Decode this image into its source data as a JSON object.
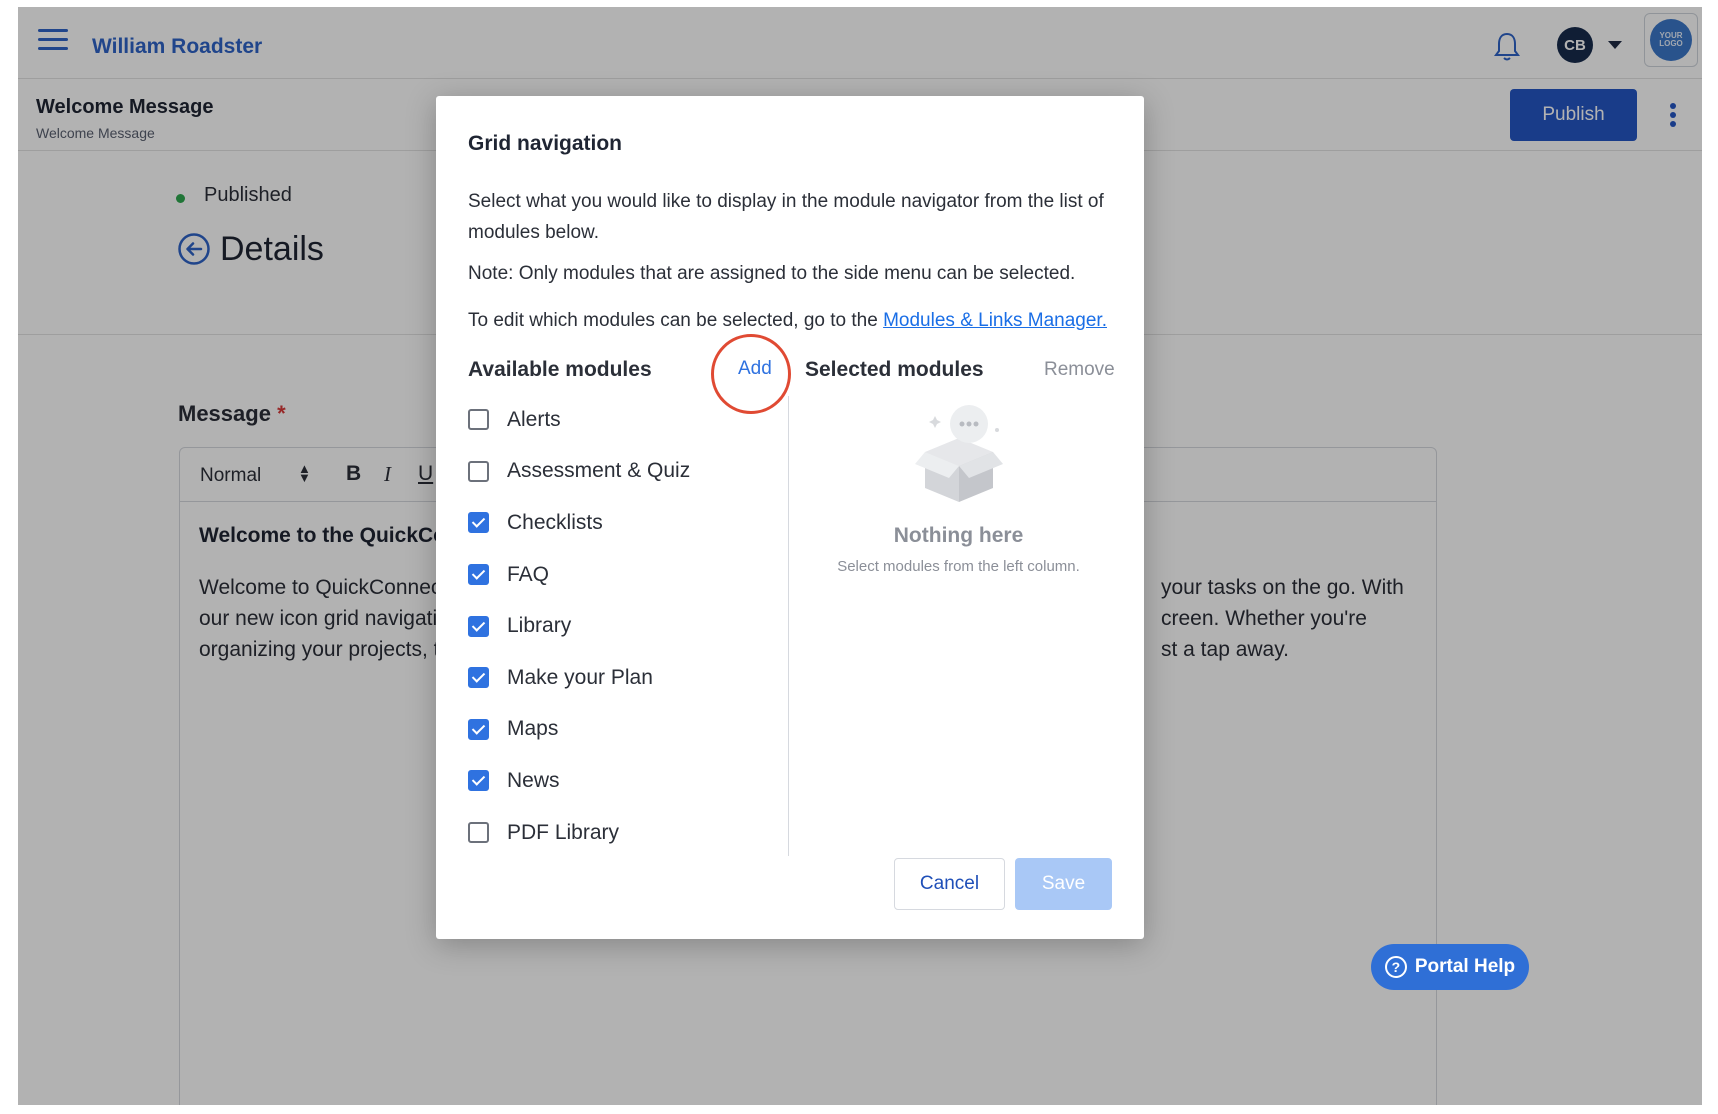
{
  "app": {
    "title": "William Roadster",
    "avatar_initials": "CB",
    "logo_text": "YOUR LOGO"
  },
  "subheader": {
    "title": "Welcome Message",
    "breadcrumb": "Welcome Message",
    "publish_label": "Publish"
  },
  "content": {
    "status": "Published",
    "heading": "Details",
    "message_label": "Message",
    "required_mark": "*",
    "editor": {
      "format": "Normal",
      "bold": "B",
      "italic": "I",
      "underline": "U",
      "heading": "Welcome to the QuickCon",
      "line1_left": "Welcome to QuickConnect!",
      "line1_right": "your tasks on the go. With",
      "line2_left": "our new icon grid navigatio",
      "line2_right": "creen. Whether you're",
      "line3_left": "organizing your projects, tr",
      "line3_right": "st a tap away."
    }
  },
  "portal_help": "Portal Help",
  "modal": {
    "title": "Grid navigation",
    "description": "Select what you would like to display in the module navigator from the list of modules below.",
    "note": "Note: Only modules that are assigned to the side menu can be selected.",
    "edit_prefix": "To edit which modules can be selected, go to the ",
    "edit_link": "Modules & Links Manager.",
    "available_heading": "Available modules",
    "add_label": "Add",
    "selected_heading": "Selected modules",
    "remove_label": "Remove",
    "modules": [
      {
        "label": "Alerts",
        "checked": false
      },
      {
        "label": "Assessment & Quiz",
        "checked": false
      },
      {
        "label": "Checklists",
        "checked": true
      },
      {
        "label": "FAQ",
        "checked": true
      },
      {
        "label": "Library",
        "checked": true
      },
      {
        "label": "Make your Plan",
        "checked": true
      },
      {
        "label": "Maps",
        "checked": true
      },
      {
        "label": "News",
        "checked": true
      },
      {
        "label": "PDF Library",
        "checked": false
      }
    ],
    "empty_title": "Nothing here",
    "empty_subtitle": "Select modules from the left column.",
    "cancel_label": "Cancel",
    "save_label": "Save"
  },
  "colors": {
    "brand": "#2456c5",
    "link": "#1a6ee6",
    "checkbox_on": "#2f72e0",
    "annotation_ring": "#e04a33",
    "status_published": "#2fa84f"
  }
}
